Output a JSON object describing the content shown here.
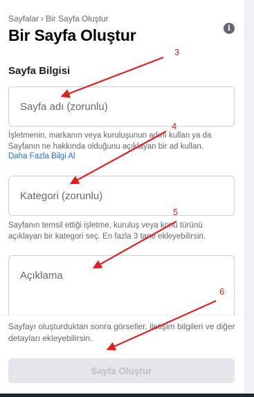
{
  "breadcrumb": {
    "parent": "Sayfalar",
    "separator": "›",
    "current": "Bir Sayfa Oluştur"
  },
  "header": {
    "title": "Bir Sayfa Oluştur",
    "info_icon": "info-icon"
  },
  "section": {
    "title": "Sayfa Bilgisi"
  },
  "fields": {
    "name": {
      "placeholder": "Sayfa adı (zorunlu)",
      "helper": "İşletmenin, markanın veya kuruluşunun adını kullan ya da Sayfanın ne hakkında olduğunu açıklayan bir ad kullan.",
      "link": "Daha Fazla Bilgi Al"
    },
    "category": {
      "placeholder": "Kategori (zorunlu)",
      "helper": "Sayfanın temsil ettiği işletme, kuruluş veya konu türünü açıklayan bir kategori seç. En fazla 3 tane ekleyebilirsin."
    },
    "description": {
      "placeholder": "Açıklama"
    }
  },
  "footer": {
    "text": "Sayfayı oluşturduktan sonra görseller, iletişim bilgileri ve diğer detayları ekleyebilirsin.",
    "create_button": "Sayfa Oluştur"
  },
  "annotations": {
    "color": "#e02020",
    "labels": [
      "3",
      "4",
      "5",
      "6"
    ]
  },
  "colors": {
    "link": "#216fdb",
    "button_disabled_bg": "#e4e6eb",
    "button_disabled_text": "#bcc0c4"
  }
}
